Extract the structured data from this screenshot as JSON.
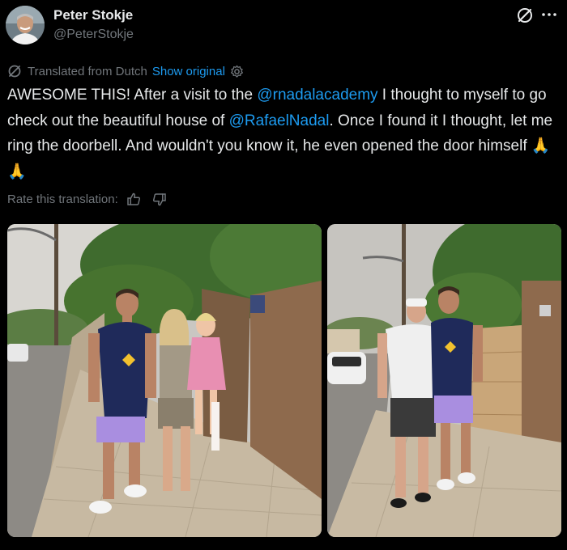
{
  "author": {
    "display_name": "Peter Stokje",
    "handle": "@PeterStokje",
    "avatar_icon": "profile-photo"
  },
  "translation": {
    "label": "Translated from Dutch",
    "show_original": "Show original"
  },
  "tweet": {
    "text_1": "AWESOME THIS! After a visit to the ",
    "mention_1": "@rnadalacademy",
    "text_2": " I thought to myself to go check out the beautiful house of ",
    "mention_2": "@RafaelNadal",
    "text_3": ". Once I found it I thought, let me ring the doorbell. And wouldn't you know it, he even opened the door himself ",
    "emoji": "🙏🙏"
  },
  "rating": {
    "label": "Rate this translation:"
  },
  "media": [
    {
      "kind": "photo",
      "subject": "Rafael Nadal with woman and child at gate"
    },
    {
      "kind": "photo",
      "subject": "Rafael Nadal with man in white cap at gate"
    }
  ],
  "colors": {
    "background": "#000000",
    "text": "#e7e9ea",
    "secondary": "#71767b",
    "link": "#1d9bf0"
  }
}
